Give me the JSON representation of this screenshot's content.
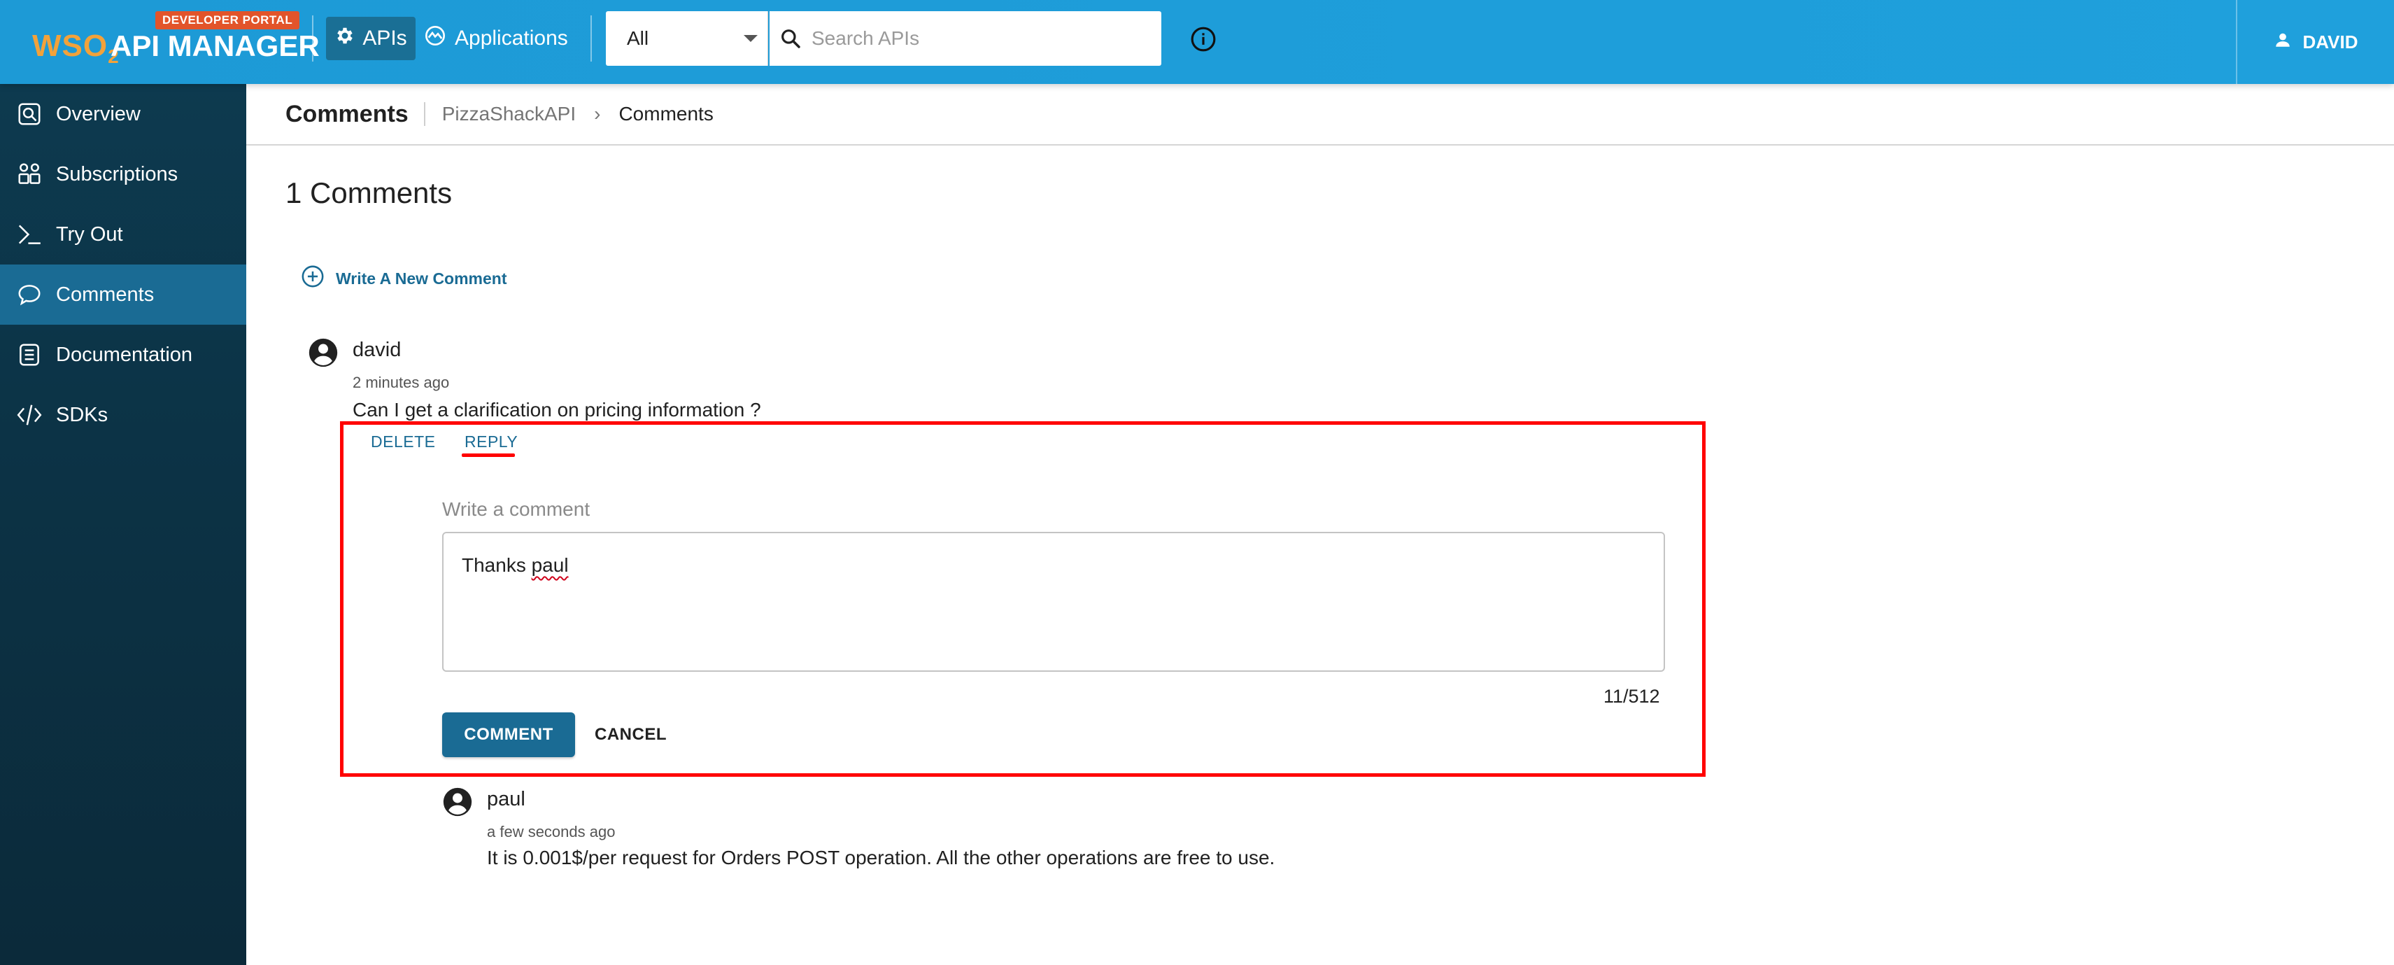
{
  "topbar": {
    "logo_badge": "DEVELOPER PORTAL",
    "logo_brand": "WSO",
    "logo_brand_sub": "2",
    "logo_product": "API MANAGER",
    "nav_apis": "APIs",
    "nav_applications": "Applications",
    "search_scope": "All",
    "search_placeholder": "Search APIs",
    "user_name": "DAVID",
    "bar_color": "#1fa0dc",
    "active_nav_color": "#1a6f95"
  },
  "sidebar": {
    "items": [
      {
        "label": "Overview",
        "icon": "overview-icon"
      },
      {
        "label": "Subscriptions",
        "icon": "subscriptions-icon"
      },
      {
        "label": "Try Out",
        "icon": "terminal-icon"
      },
      {
        "label": "Comments",
        "icon": "comment-icon",
        "active": true
      },
      {
        "label": "Documentation",
        "icon": "documentation-icon"
      },
      {
        "label": "SDKs",
        "icon": "code-icon"
      }
    ],
    "active_color": "#1a6b94"
  },
  "header": {
    "title": "Comments",
    "breadcrumb_api": "PizzaShackAPI",
    "breadcrumb_current": "Comments"
  },
  "main": {
    "count_title": "1 Comments",
    "write_new_label": "Write A New Comment",
    "comment": {
      "user": "david",
      "time": "2 minutes ago",
      "text": "Can I get a clarification on pricing information ?",
      "delete_label": "DELETE",
      "reply_label": "REPLY"
    },
    "reply_form": {
      "label": "Write a comment",
      "value_prefix": "Thanks ",
      "value_misspelled": "paul",
      "char_count": "11/512",
      "comment_button": "COMMENT",
      "cancel_button": "CANCEL"
    },
    "reply": {
      "user": "paul",
      "time": "a few seconds ago",
      "text": "It is 0.001$/per request for Orders POST operation. All the other operations are free to use."
    },
    "highlight_color": "#ff0000"
  }
}
